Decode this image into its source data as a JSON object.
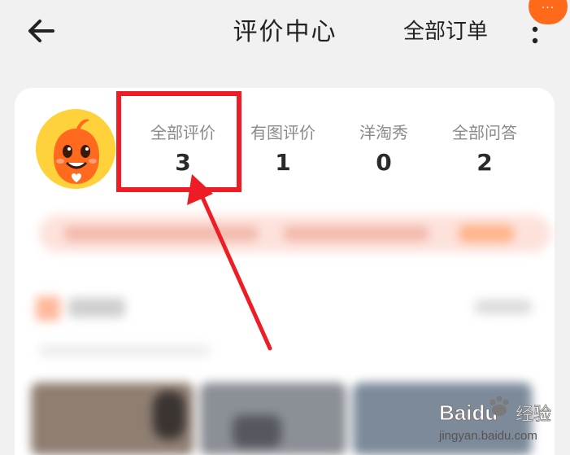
{
  "header": {
    "title": "评价中心",
    "all_orders": "全部订单",
    "badge_text": "···"
  },
  "stats": [
    {
      "label": "全部评价",
      "count": "3"
    },
    {
      "label": "有图评价",
      "count": "1"
    },
    {
      "label": "洋淘秀",
      "count": "0"
    },
    {
      "label": "全部问答",
      "count": "2"
    }
  ],
  "colors": {
    "accent": "#ff6a1a",
    "annotation": "#ee1c25",
    "card": "#ffffff",
    "background": "#f1f1f1"
  },
  "icons": {
    "back": "arrow-left-icon",
    "more": "more-vertical-icon",
    "avatar": "mascot-avatar"
  },
  "watermark": {
    "brand": "Baidu",
    "cn": "经验",
    "url": "jingyan.baidu.com"
  }
}
